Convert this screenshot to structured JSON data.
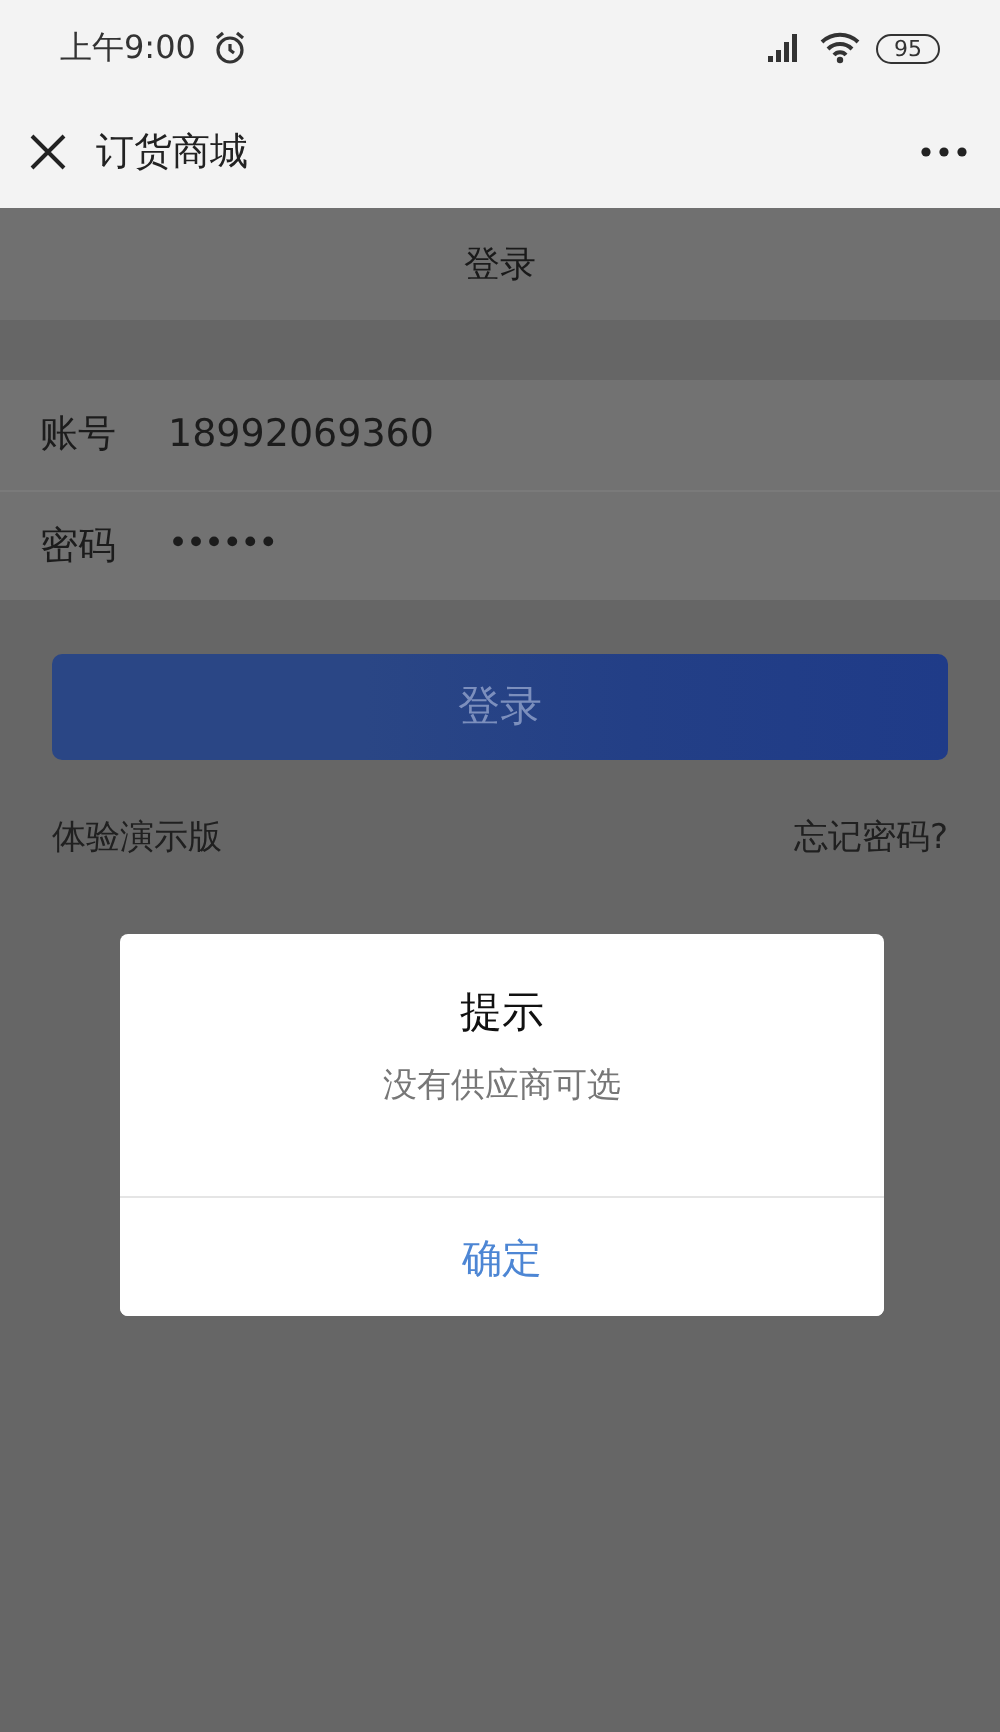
{
  "status_bar": {
    "time": "上午9:00",
    "battery": "95"
  },
  "nav_bar": {
    "title": "订货商城"
  },
  "page": {
    "header": "登录",
    "fields": [
      {
        "label": "账号",
        "value": "18992069360",
        "kind": "text"
      },
      {
        "label": "密码",
        "value": "••••••",
        "kind": "password"
      }
    ],
    "login_button": "登录",
    "demo_link": "体验演示版",
    "forgot_link": "忘记密码?"
  },
  "dialog": {
    "title": "提示",
    "message": "没有供应商可选",
    "button": "确定"
  }
}
